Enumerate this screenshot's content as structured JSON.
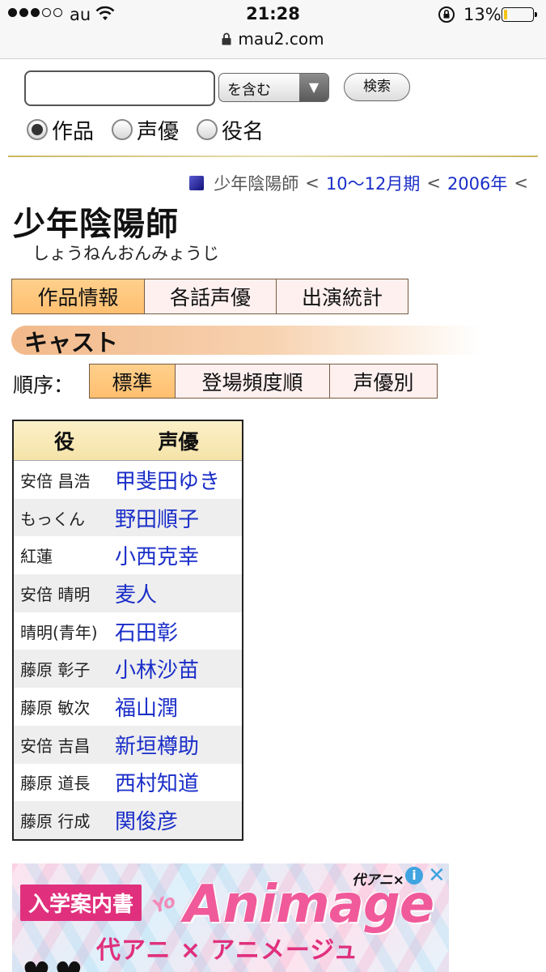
{
  "status_bar": {
    "carrier": "au",
    "time": "21:28",
    "battery": "13%",
    "battery_level": 0.13,
    "signal_filled": 3,
    "signal_total": 5
  },
  "url_bar": {
    "domain": "mau2.com"
  },
  "search": {
    "value": "",
    "mode": "を含む",
    "button": "検索",
    "options": [
      {
        "label": "作品",
        "selected": true
      },
      {
        "label": "声優",
        "selected": false
      },
      {
        "label": "役名",
        "selected": false
      }
    ]
  },
  "breadcrumb": {
    "current": "少年陰陽師",
    "separator": "<",
    "links": [
      "10〜12月期",
      "2006年"
    ]
  },
  "title": "少年陰陽師",
  "title_reading": "しょうねんおんみょうじ",
  "main_tabs": [
    {
      "label": "作品情報",
      "active": true
    },
    {
      "label": "各話声優",
      "active": false
    },
    {
      "label": "出演統計",
      "active": false
    }
  ],
  "section_heading": "キャスト",
  "order": {
    "label": "順序：",
    "tabs": [
      {
        "label": "標準",
        "active": true
      },
      {
        "label": "登場頻度順",
        "active": false
      },
      {
        "label": "声優別",
        "active": false
      }
    ]
  },
  "cast_table": {
    "headers": {
      "role": "役",
      "voice_actor": "声優"
    },
    "rows": [
      {
        "role": "安倍 昌浩",
        "voice_actor": "甲斐田ゆき"
      },
      {
        "role": "もっくん",
        "voice_actor": "野田順子"
      },
      {
        "role": "紅蓮",
        "voice_actor": "小西克幸"
      },
      {
        "role": "安倍 晴明",
        "voice_actor": "麦人"
      },
      {
        "role": "晴明(青年)",
        "voice_actor": "石田彰"
      },
      {
        "role": "藤原 彰子",
        "voice_actor": "小林沙苗"
      },
      {
        "role": "藤原 敏次",
        "voice_actor": "福山潤"
      },
      {
        "role": "安倍 吉昌",
        "voice_actor": "新垣樽助"
      },
      {
        "role": "藤原 道長",
        "voice_actor": "西村知道"
      },
      {
        "role": "藤原 行成",
        "voice_actor": "関俊彦"
      }
    ]
  },
  "ad": {
    "badge": "入学案内書",
    "yo": "Yo",
    "logo": "Animage",
    "brand": "代アニ×",
    "subtitle": "代アニ × アニメージュ",
    "info_icon": "info-icon",
    "close_icon": "close-icon"
  }
}
